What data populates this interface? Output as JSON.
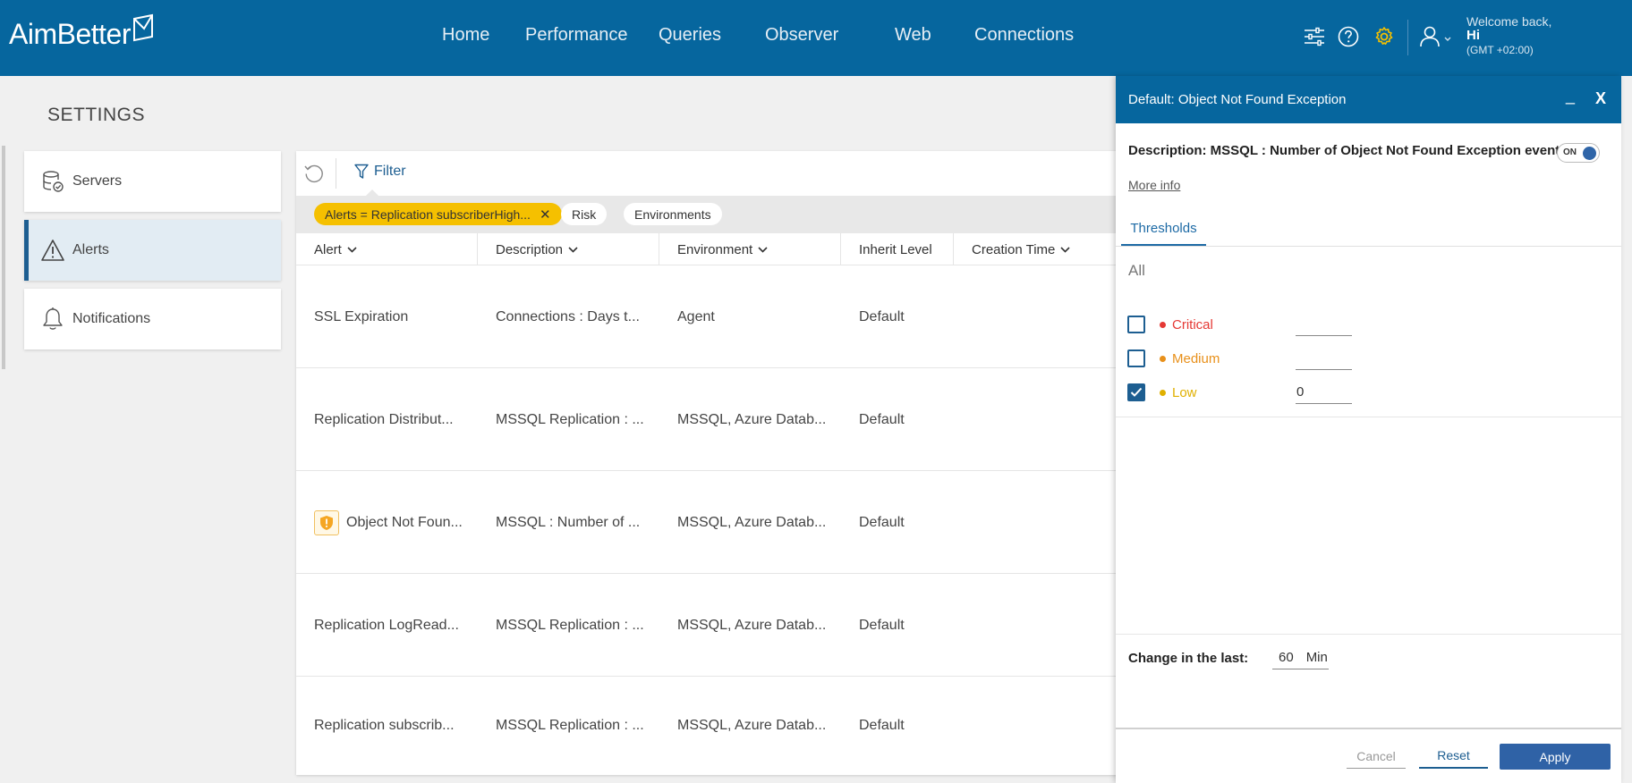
{
  "header": {
    "logo_text": "AimBetter",
    "nav": [
      "Home",
      "Performance",
      "Queries",
      "Observer",
      "Web",
      "Connections"
    ],
    "icons": [
      "sliders-icon",
      "help-icon",
      "gear-icon",
      "user-icon"
    ],
    "welcome_line1": "Welcome back,",
    "welcome_name": "Hi",
    "timezone": "(GMT +02:00)",
    "accent_gear_color": "#f5c000"
  },
  "page": {
    "title": "SETTINGS"
  },
  "sidebar": {
    "items": [
      {
        "label": "Servers",
        "icon": "database-icon"
      },
      {
        "label": "Alerts",
        "icon": "warning-icon",
        "active": true
      },
      {
        "label": "Notifications",
        "icon": "bell-icon"
      }
    ]
  },
  "toolbar": {
    "filter_label": "Filter"
  },
  "chips": [
    {
      "label": "Alerts = Replication subscriberHigh...",
      "active": true
    },
    {
      "label": "Risk"
    },
    {
      "label": "Environments"
    }
  ],
  "table": {
    "columns": [
      "Alert",
      "Description",
      "Environment",
      "Inherit Level",
      "Creation Time"
    ],
    "rows": [
      {
        "alert": "SSL Expiration",
        "description": "Connections : Days t...",
        "environment": "Agent",
        "inherit": "Default"
      },
      {
        "alert": "Replication Distribut...",
        "description": "MSSQL Replication : ...",
        "environment": "MSSQL, Azure Datab...",
        "inherit": "Default"
      },
      {
        "alert": "Object Not Foun...",
        "description": "MSSQL : Number of ...",
        "environment": "MSSQL, Azure Datab...",
        "inherit": "Default",
        "icon": "shield-alert-icon"
      },
      {
        "alert": "Replication LogRead...",
        "description": "MSSQL Replication : ...",
        "environment": "MSSQL, Azure Datab...",
        "inherit": "Default"
      },
      {
        "alert": "Replication subscrib...",
        "description": "MSSQL Replication : ...",
        "environment": "MSSQL, Azure Datab...",
        "inherit": "Default"
      }
    ]
  },
  "drawer": {
    "title": "Default: Object Not Found Exception",
    "minimize": "_",
    "close": "X",
    "description": "Description: MSSQL : Number of Object Not Found Exception events",
    "toggle_label": "ON",
    "more_info": "More info",
    "tab": "Thresholds",
    "all_label": "All",
    "thresholds": [
      {
        "label": "Critical",
        "color": "#e53935",
        "checked": false,
        "value": ""
      },
      {
        "label": "Medium",
        "color": "#e8901a",
        "checked": false,
        "value": ""
      },
      {
        "label": "Low",
        "color": "#e0b000",
        "checked": true,
        "value": "0"
      }
    ],
    "change_label": "Change in the last:",
    "change_value": "60",
    "change_unit": "Min",
    "buttons": {
      "cancel": "Cancel",
      "reset": "Reset",
      "apply": "Apply"
    }
  }
}
